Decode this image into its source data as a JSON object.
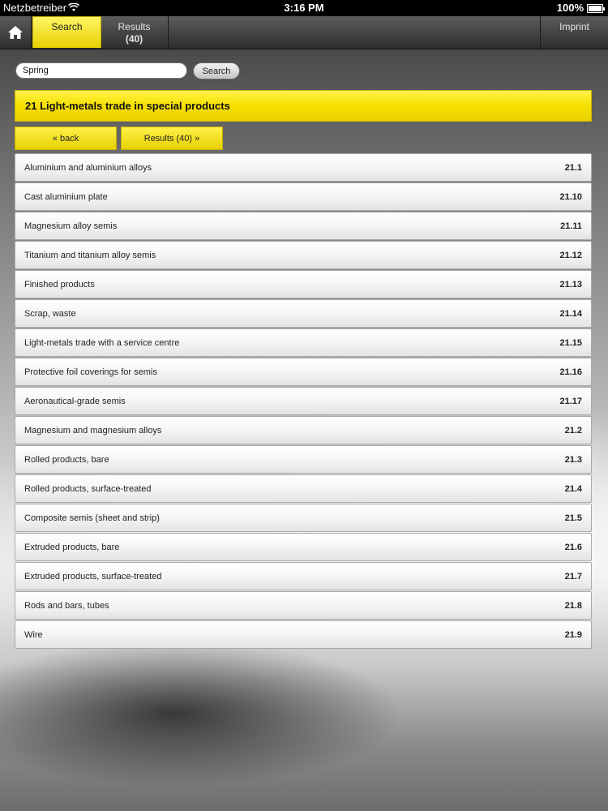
{
  "status_bar": {
    "carrier": "Netzbetreiber",
    "time": "3:16 PM",
    "battery": "100%"
  },
  "nav": {
    "home_icon": "home-icon",
    "search_tab": "Search",
    "results_tab": "Results",
    "results_count": "(40)",
    "imprint": "Imprint"
  },
  "search": {
    "value": "Spring",
    "button": "Search"
  },
  "category_title": "21 Light-metals trade in special products",
  "buttons": {
    "back": "« back",
    "results": "Results (40) »"
  },
  "colors": {
    "accent_yellow": "#f7e000",
    "nav_dark": "#2d2d2d"
  },
  "rows": [
    {
      "name": "Aluminium and aluminium alloys",
      "code": "21.1"
    },
    {
      "name": "Cast aluminium plate",
      "code": "21.10"
    },
    {
      "name": "Magnesium alloy semis",
      "code": "21.11"
    },
    {
      "name": "Titanium and titanium alloy semis",
      "code": "21.12"
    },
    {
      "name": "Finished products",
      "code": "21.13"
    },
    {
      "name": "Scrap, waste",
      "code": "21.14"
    },
    {
      "name": "Light-metals trade with a service centre",
      "code": "21.15"
    },
    {
      "name": "Protective foil coverings for semis",
      "code": "21.16"
    },
    {
      "name": "Aeronautical-grade semis",
      "code": "21.17"
    },
    {
      "name": "Magnesium and magnesium alloys",
      "code": "21.2"
    },
    {
      "name": "Rolled products, bare",
      "code": "21.3"
    },
    {
      "name": "Rolled products, surface-treated",
      "code": "21.4"
    },
    {
      "name": "Composite semis (sheet and strip)",
      "code": "21.5"
    },
    {
      "name": "Extruded products, bare",
      "code": "21.6"
    },
    {
      "name": "Extruded products, surface-treated",
      "code": "21.7"
    },
    {
      "name": "Rods and bars, tubes",
      "code": "21.8"
    },
    {
      "name": "Wire",
      "code": "21.9"
    }
  ]
}
